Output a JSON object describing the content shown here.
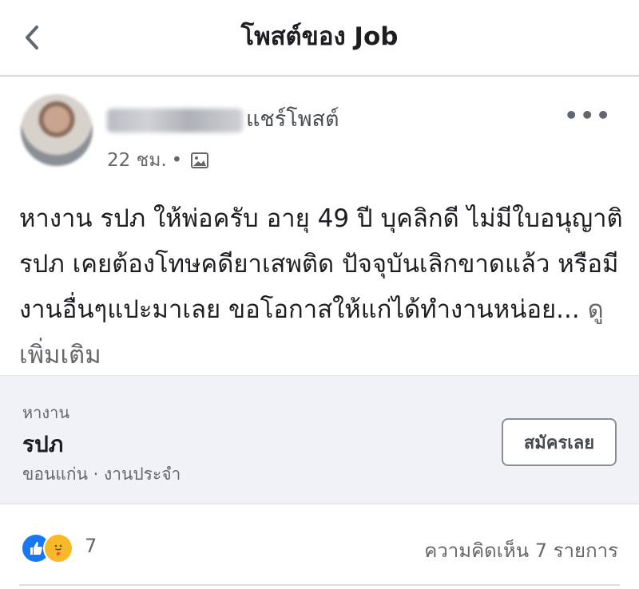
{
  "header": {
    "title": "โพสต์ของ Job",
    "back_icon": "chevron-left-icon"
  },
  "post": {
    "action_text": "แชร์โพสต์",
    "timestamp": "22 ชม.",
    "separator": "•",
    "privacy_icon": "photo-icon",
    "more_icon": "more-horizontal-icon",
    "more_label": "•••",
    "body": "หางาน รปภ ให้พ่อครับ อายุ 49 ปี บุคลิกดี ไม่มีใบอนุญาติ รปภ เคยต้องโทษคดียาเสพติด ปัจจุบันเลิกขาดแล้ว หรือมีงานอื่นๆแปะมาเลย ขอโอกาสให้แก่ได้ทำงานหน่อย...",
    "see_more": "ดูเพิ่มเติม"
  },
  "job": {
    "category": "หางาน",
    "title": "รปภ",
    "meta": "ขอนแก่น · งานประจำ",
    "apply_label": "สมัครเลย"
  },
  "engagement": {
    "reaction_icons": [
      "like-icon",
      "care-icon"
    ],
    "reaction_count": "7",
    "comments_label": "ความคิดเห็น 7 รายการ"
  },
  "colors": {
    "like_blue": "#1877f2",
    "care_yellow": "#f7b928",
    "card_bg": "#f0f2f5",
    "secondary_text": "#65676b"
  }
}
